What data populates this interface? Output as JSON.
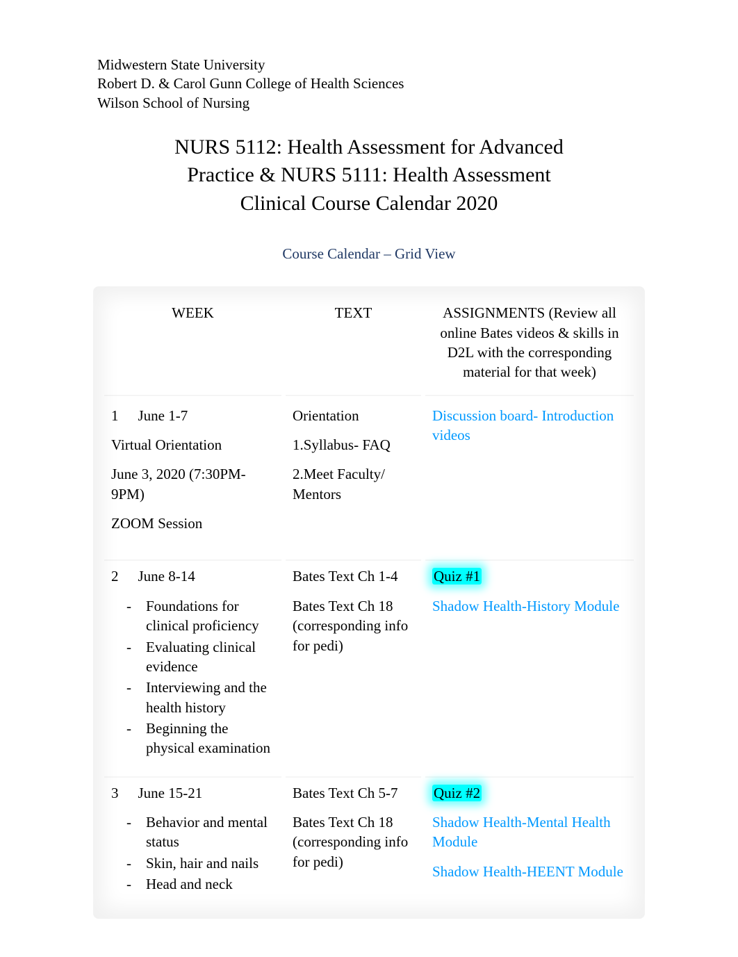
{
  "header": {
    "line1": "Midwestern State University",
    "line2": "Robert D. & Carol Gunn College of Health Sciences",
    "line3": "Wilson School of Nursing"
  },
  "course_title": "NURS 5112: Health Assessment for Advanced Practice & NURS 5111: Health Assessment Clinical Course Calendar 2020",
  "grid_label": "Course Calendar – Grid View",
  "columns": {
    "week": "WEEK",
    "text": "TEXT",
    "assignments": "ASSIGNMENTS (Review all online Bates videos & skills in D2L with the corresponding material for that week)"
  },
  "rows": [
    {
      "num": "1",
      "date": "June 1-7",
      "week_extra": [
        "Virtual Orientation",
        "June 3, 2020 (7:30PM-9PM)",
        "ZOOM Session"
      ],
      "topics": [],
      "text_lines": [
        "Orientation",
        "1.Syllabus- FAQ",
        "2.Meet Faculty/ Mentors"
      ],
      "assignments": [
        {
          "label": "Discussion board- Introduction videos",
          "type": "link"
        }
      ]
    },
    {
      "num": "2",
      "date": "June 8-14",
      "week_extra": [],
      "topics": [
        "Foundations for clinical proficiency",
        "Evaluating clinical evidence",
        "Interviewing and the health history",
        "Beginning the physical examination"
      ],
      "text_lines": [
        "Bates Text Ch 1-4",
        "Bates Text Ch 18 (corresponding info for pedi)"
      ],
      "assignments": [
        {
          "label": "Quiz #1",
          "type": "highlight"
        },
        {
          "label": "Shadow Health-History Module",
          "type": "link"
        }
      ]
    },
    {
      "num": "3",
      "date": "June 15-21",
      "week_extra": [],
      "topics": [
        "Behavior and mental status",
        "Skin, hair and nails",
        "Head and neck"
      ],
      "text_lines": [
        "Bates Text Ch 5-7",
        "Bates Text Ch 18 (corresponding info for pedi)"
      ],
      "assignments": [
        {
          "label": "Quiz #2",
          "type": "highlight"
        },
        {
          "label": "Shadow Health-Mental Health Module",
          "type": "link"
        },
        {
          "label": "Shadow Health-HEENT Module",
          "type": "link"
        }
      ]
    }
  ]
}
